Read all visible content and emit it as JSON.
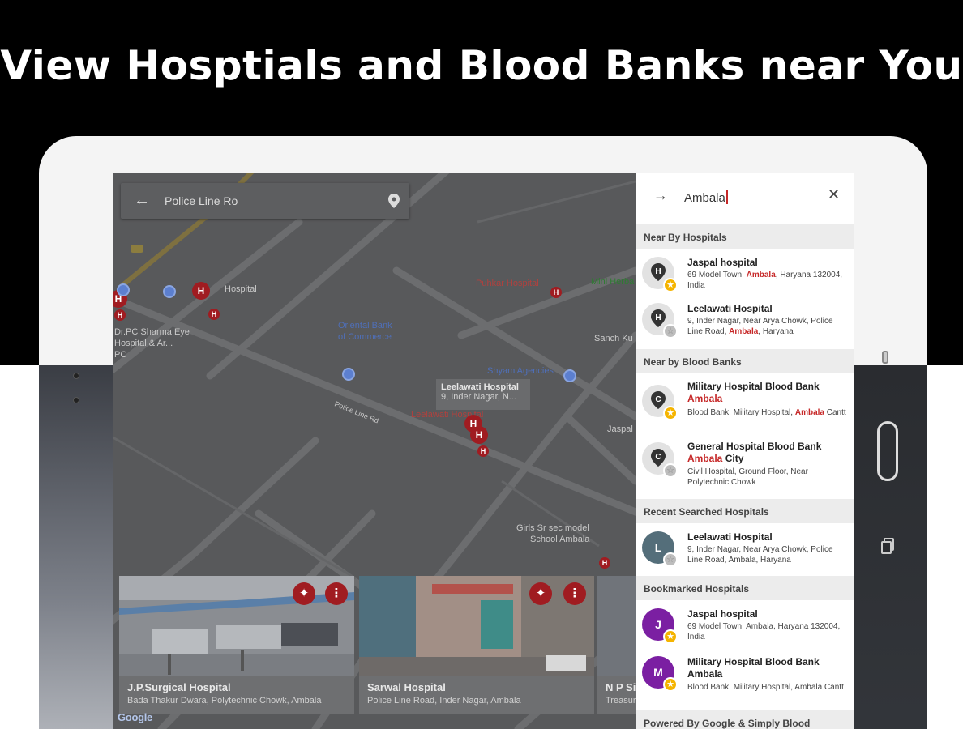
{
  "headline": "View Hosptials and Blood Banks near You",
  "map": {
    "search_value": "Police Line Ro",
    "labels": {
      "hospital_frag": "Hospital",
      "sharma_1": "Dr.PC Sharma Eye",
      "sharma_2": "Hospital & Ar...",
      "sharma_3": "PC",
      "puhkar": "Puhkar Hospital",
      "mini_herbal": "Mini Herba",
      "bank_1": "Oriental Bank",
      "bank_2": "of Commerce",
      "shyam": "Shyam Agencies",
      "sanch": "Sanch Ku",
      "road": "Police Line Rd",
      "leelawati_map": "Leelawati Hospital",
      "jaspal_frag": "Jaspal",
      "girls_1": "Girls Sr sec model",
      "girls_2": "School Ambala"
    },
    "tooltip_title": "Leelawati Hospital",
    "tooltip_sub": "9, Inder Nagar, N...",
    "google": "Google",
    "cards": [
      {
        "name": "J.P.Surgical Hospital",
        "address": "Bada Thakur Dwara, Polytechnic Chowk, Ambala"
      },
      {
        "name": "Sarwal Hospital",
        "address": "Police Line Road, Inder Nagar, Ambala"
      },
      {
        "name": "N P Si",
        "address": "Treasur"
      }
    ]
  },
  "panel": {
    "query": "Ambala",
    "sections": {
      "near_hospitals": "Near By Hospitals",
      "near_blood_banks": "Near by Blood Banks",
      "recent": "Recent Searched Hospitals",
      "bookmarked": "Bookmarked Hospitals"
    },
    "near_hospitals": [
      {
        "title": "Jaspal hospital",
        "sub_pre": "69 Model Town, ",
        "sub_hl": "Ambala",
        "sub_post": ", Haryana 132004, India",
        "starred": true
      },
      {
        "title": "Leelawati Hospital",
        "sub_pre": "9, Inder Nagar, Near Arya Chowk, Police Line Road, ",
        "sub_hl": "Ambala",
        "sub_post": ", Haryana",
        "starred": false
      }
    ],
    "near_blood_banks": [
      {
        "title": "Military Hospital Blood Bank",
        "title_hl": "Ambala",
        "title_post": "",
        "sub_pre": "Blood Bank, Military Hospital, ",
        "sub_hl": "Ambala",
        "sub_post": " Cantt",
        "starred": true
      },
      {
        "title": "General Hospital Blood Bank",
        "title_hl": "Ambala",
        "title_post": " City",
        "sub_pre": "Civil Hospital, Ground Floor, Near Polytechnic Chowk",
        "sub_hl": "",
        "sub_post": "",
        "starred": false
      }
    ],
    "recent": [
      {
        "letter": "L",
        "title": "Leelawati Hospital",
        "sub": "9, Inder Nagar, Near Arya Chowk, Police Line Road, Ambala, Haryana",
        "color": "#546e7a",
        "starred": false
      }
    ],
    "bookmarked": [
      {
        "letter": "J",
        "title": "Jaspal hospital",
        "sub": "69 Model Town, Ambala, Haryana 132004, India",
        "color": "#7b1fa2",
        "starred": true
      },
      {
        "letter": "M",
        "title": "Military Hospital Blood Bank Ambala",
        "sub": "Blood Bank, Military Hospital, Ambala Cantt",
        "color": "#7b1fa2",
        "starred": true
      }
    ],
    "footer": "Powered By Google & Simply Blood"
  },
  "colors": {
    "accent": "#c62828",
    "pin": "#a01c21",
    "star": "#f5b400",
    "purple": "#7b1fa2"
  }
}
